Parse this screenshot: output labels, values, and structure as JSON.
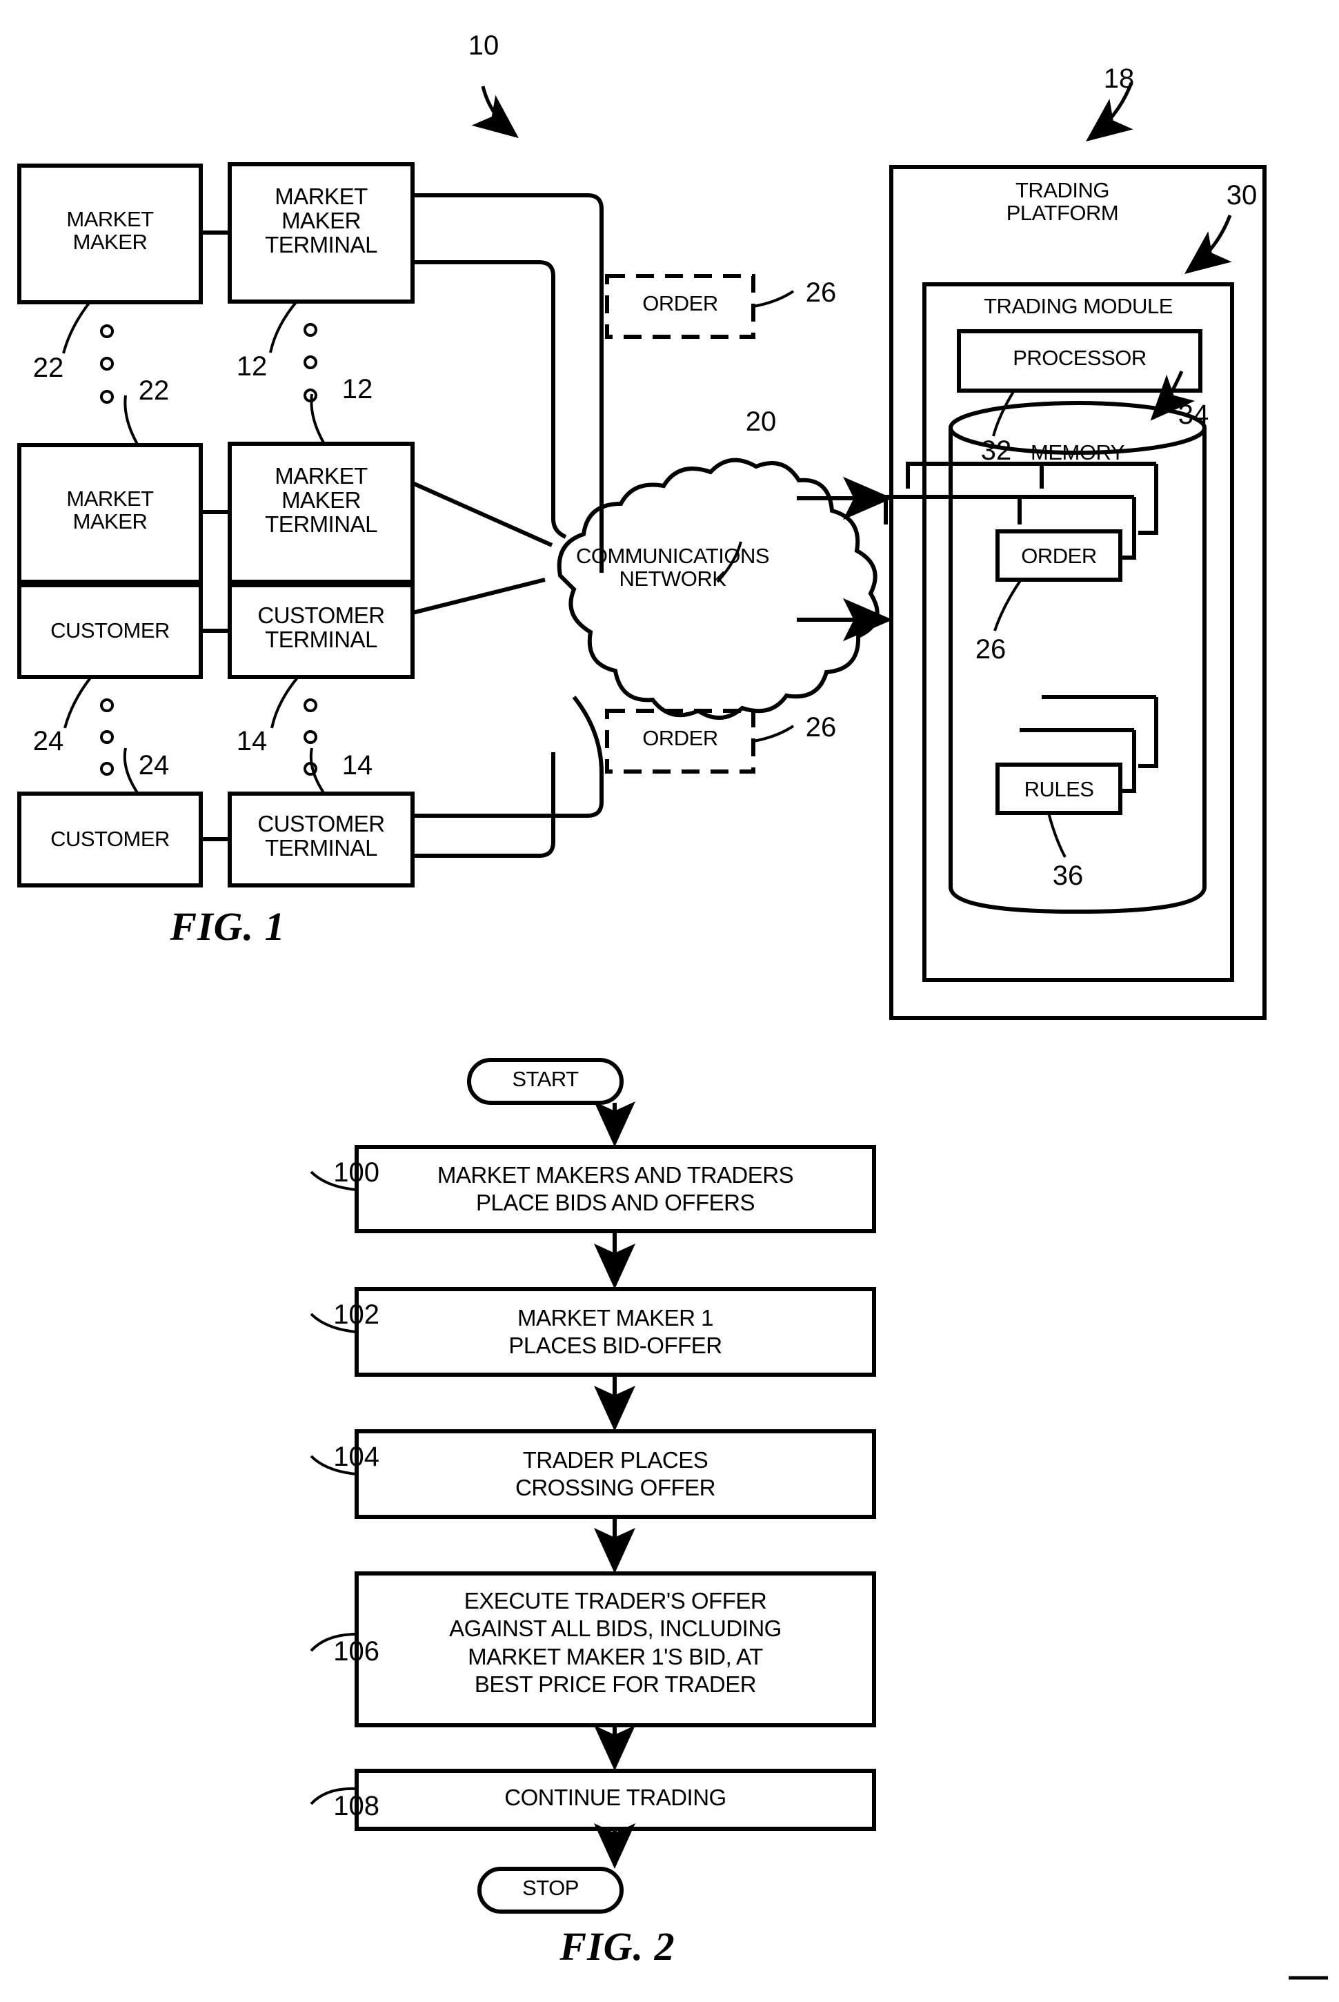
{
  "figure1": {
    "caption": "FIG. 1",
    "system_ref": "10",
    "left_column": [
      {
        "name": "MARKET\nMAKER",
        "ref": "22"
      },
      {
        "name": "MARKET\nMAKER",
        "ref": "22"
      },
      {
        "name": "CUSTOMER",
        "ref": "24"
      },
      {
        "name": "CUSTOMER",
        "ref": "24"
      }
    ],
    "terminal_column": [
      {
        "name": "MARKET\nMAKER\nTERMINAL",
        "ref": "12"
      },
      {
        "name": "MARKET\nMAKER\nTERMINAL",
        "ref": "12"
      },
      {
        "name": "CUSTOMER\nTERMINAL",
        "ref": "14"
      },
      {
        "name": "CUSTOMER\nTERMINAL",
        "ref": "14"
      }
    ],
    "order_packets": [
      {
        "label": "ORDER",
        "ref": "26"
      },
      {
        "label": "ORDER",
        "ref": "26"
      }
    ],
    "network": {
      "label": "COMMUNICATIONS\nNETWORK",
      "ref": "20"
    },
    "platform": {
      "label": "TRADING\nPLATFORM",
      "ref": "18",
      "module": {
        "label": "TRADING MODULE",
        "ref": "30",
        "processor": {
          "label": "PROCESSOR",
          "ref": "32"
        },
        "memory": {
          "label": "MEMORY",
          "ref": "34",
          "stacks": [
            {
              "label": "ORDER",
              "ref": "26"
            },
            {
              "label": "RULES",
              "ref": "36"
            }
          ]
        }
      }
    }
  },
  "figure2": {
    "caption": "FIG. 2",
    "start_label": "START",
    "stop_label": "STOP",
    "steps": [
      {
        "ref": "100",
        "text": "MARKET MAKERS AND TRADERS\nPLACE BIDS AND OFFERS"
      },
      {
        "ref": "102",
        "text": "MARKET MAKER 1\nPLACES BID-OFFER"
      },
      {
        "ref": "104",
        "text": "TRADER PLACES\nCROSSING OFFER"
      },
      {
        "ref": "106",
        "text": "EXECUTE TRADER'S OFFER\nAGAINST ALL BIDS, INCLUDING\nMARKET MAKER 1'S BID, AT\nBEST PRICE FOR TRADER"
      },
      {
        "ref": "108",
        "text": "CONTINUE TRADING"
      }
    ]
  },
  "colors": {
    "ink": "#000000",
    "paper": "#ffffff"
  }
}
